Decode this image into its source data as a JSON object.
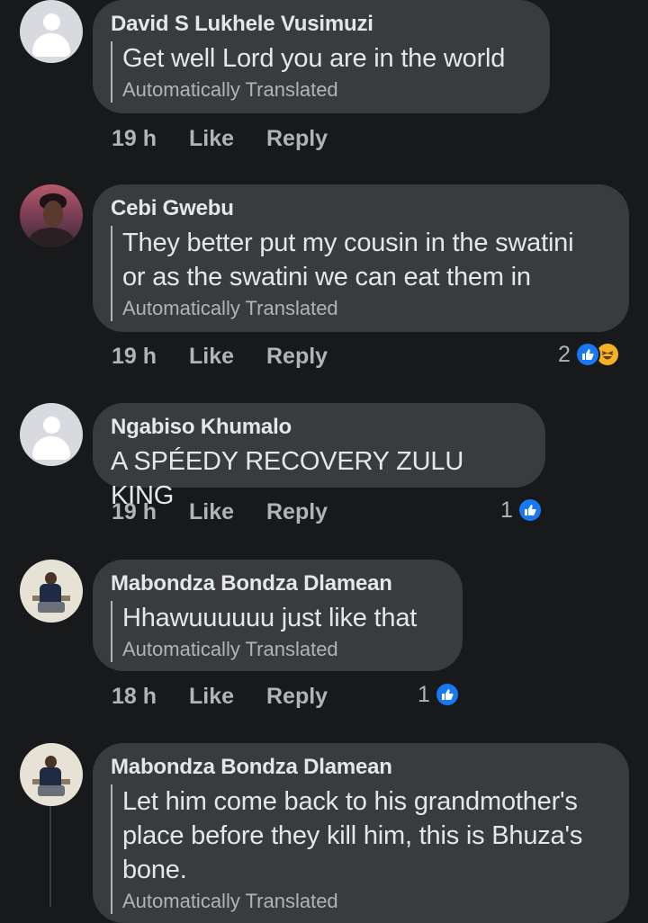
{
  "translated_label": "Automatically Translated",
  "like_label": "Like",
  "reply_label": "Reply",
  "comments": [
    {
      "author": "David S Lukhele Vusimuzi",
      "text": "Get well Lord you are in the world",
      "time": "19 h"
    },
    {
      "author": "Cebi Gwebu",
      "text_lines": [
        "They better put my cousin in the swatini",
        "or as the swatini we can eat them in"
      ],
      "time": "19 h",
      "reaction_count": "2"
    },
    {
      "author": "Ngabiso Khumalo",
      "text": "A SPÉEDY RECOVERY ZULU KING",
      "time": "19 h",
      "reaction_count": "1"
    },
    {
      "author": "Mabondza Bondza Dlamean",
      "text": "Hhawuuuuuu just like that",
      "time": "18 h",
      "reaction_count": "1"
    },
    {
      "author": "Mabondza Bondza Dlamean",
      "text_lines": [
        "Let him come back to his grandmother's",
        "place before they kill him, this is Bhuza's",
        "bone."
      ]
    }
  ],
  "colors": {
    "background": "#18191a",
    "bubble": "#3a3b3c",
    "like_blue": "#1877f2",
    "haha_yellow": "#f7b125"
  },
  "icons": [
    "default-avatar-icon",
    "like-reaction-icon",
    "haha-reaction-icon"
  ]
}
